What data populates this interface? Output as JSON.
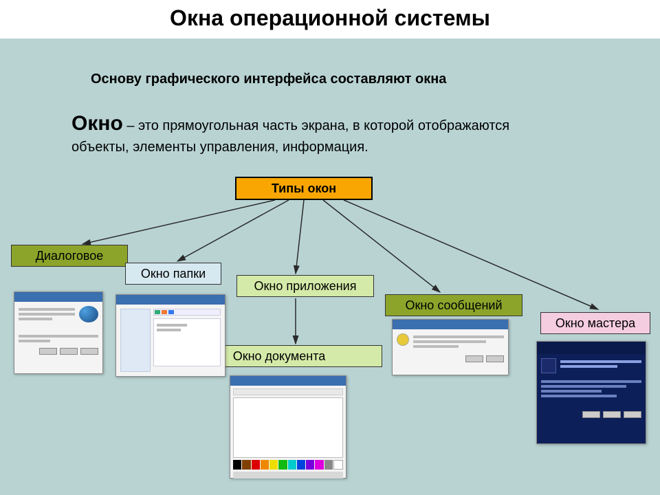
{
  "title": "Окна операционной системы",
  "intro": "Основу графического интерфейса составляют окна",
  "definition_term": "Окно",
  "definition_rest": " – это прямоугольная часть экрана, в которой отображаются объекты, элементы управления, информация.",
  "root": "Типы окон",
  "nodes": {
    "dialog": "Диалоговое",
    "folder": "Окно папки",
    "app": "Окно приложения",
    "msg": "Окно сообщений",
    "wizard": "Окно мастера",
    "doc": "Окно документа"
  }
}
